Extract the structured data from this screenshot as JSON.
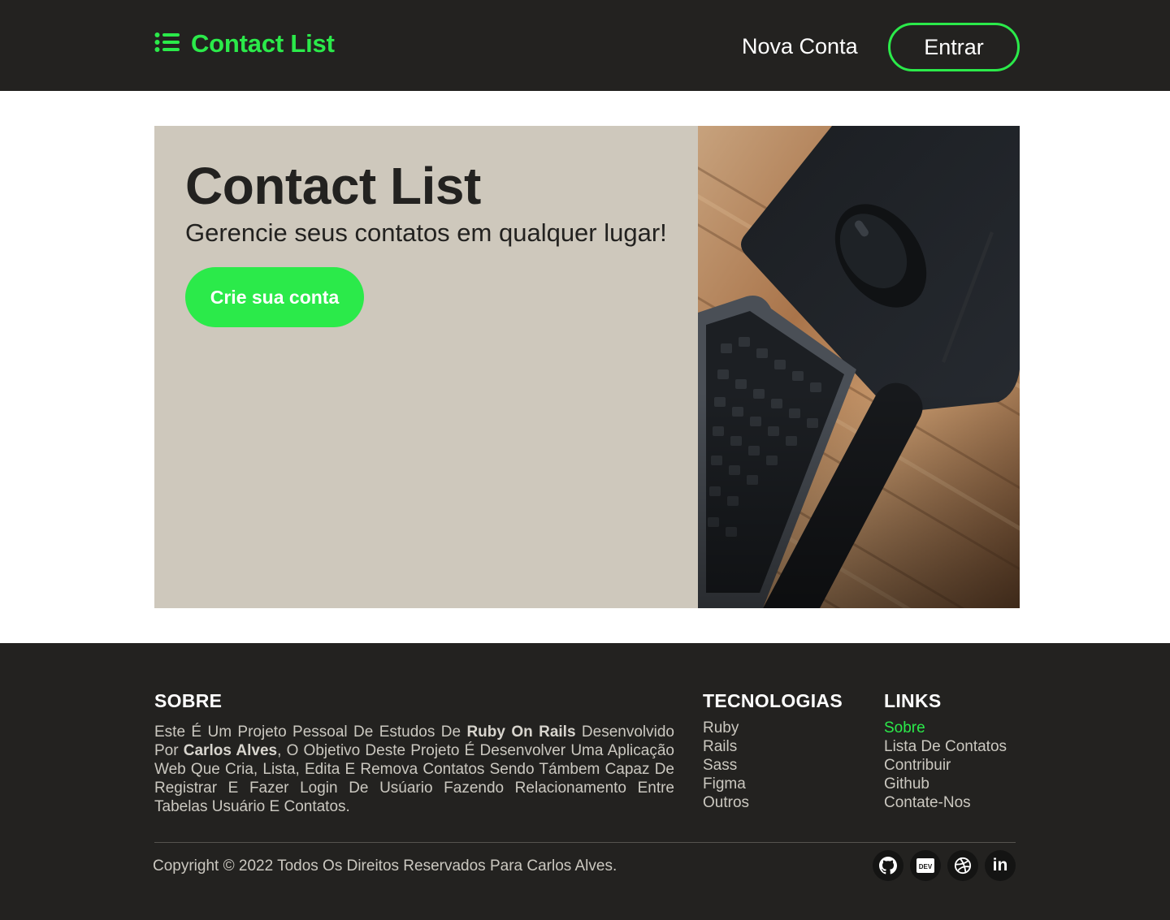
{
  "header": {
    "brand": "Contact List",
    "brand_icon": "list-icon",
    "nav_new_account": "Nova Conta",
    "login_button": "Entrar"
  },
  "hero": {
    "title": "Contact List",
    "subtitle": "Gerencie seus contatos em qualquer lugar!",
    "cta": "Crie sua conta",
    "image": "desk-keyboard-mouse-photo"
  },
  "footer": {
    "about": {
      "title": "SOBRE",
      "text_1": "Este É Um Projeto Pessoal De Estudos De ",
      "bold_1": "Ruby On Rails",
      "text_2": " Desenvolvido Por ",
      "bold_2": "Carlos Alves",
      "text_3": ", O Objetivo Deste Projeto É Desenvolver Uma Aplicação Web Que Cria, Lista, Edita E Remova Contatos Sendo Támbem Capaz De Registrar E Fazer Login De Usúario Fazendo Relacionamento Entre Tabelas Usuário E Contatos."
    },
    "tech": {
      "title": "TECNOLOGIAS",
      "items": [
        "Ruby",
        "Rails",
        "Sass",
        "Figma",
        "Outros"
      ]
    },
    "links": {
      "title": "LINKS",
      "items": [
        "Sobre",
        "Lista De Contatos",
        "Contribuir",
        "Github",
        "Contate-Nos"
      ],
      "active": "Sobre"
    },
    "copyright": "Copyright © 2022 Todos Os Direitos Reservados Para Carlos Alves.",
    "socials": [
      "github-icon",
      "dev-icon",
      "dribbble-icon",
      "linkedin-icon"
    ],
    "dev_badge": "DEV",
    "linkedin_text": "in"
  },
  "colors": {
    "accent": "#2bea4a",
    "dark": "#232220",
    "hero_bg": "#cec8bc"
  }
}
